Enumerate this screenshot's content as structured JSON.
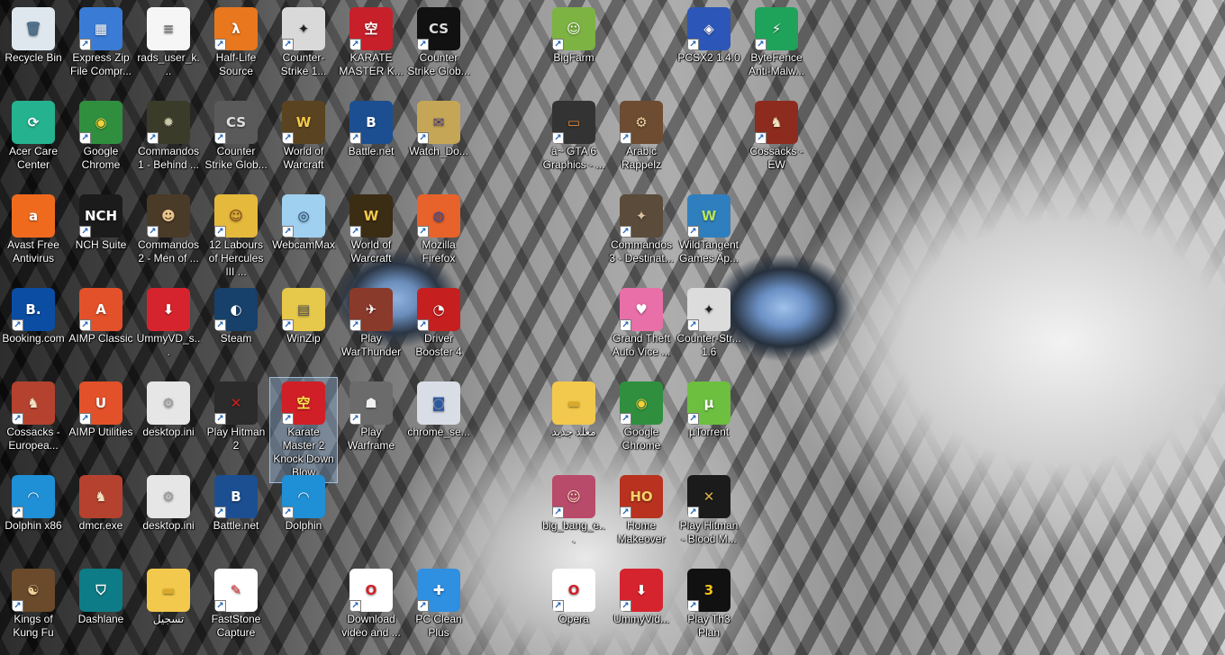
{
  "desktop": {
    "icons": [
      {
        "label": "Recycle Bin",
        "icon": "recycle-bin-icon",
        "glyph": "🗑",
        "bg": "#dfe7ee",
        "fg": "#4c6c8a",
        "shortcut": false
      },
      {
        "label": "Express Zip File Compr...",
        "icon": "express-zip-icon",
        "glyph": "▦",
        "bg": "#3a7bd5",
        "fg": "#ffffff",
        "shortcut": true
      },
      {
        "label": "rads_user_k...",
        "icon": "text-file-icon",
        "glyph": "≡",
        "bg": "#f6f6f6",
        "fg": "#777777",
        "shortcut": false
      },
      {
        "label": "Half-Life Source",
        "icon": "half-life-icon",
        "glyph": "λ",
        "bg": "#e8771d",
        "fg": "#ffffff",
        "shortcut": true
      },
      {
        "label": "Counter-Strike 1...",
        "icon": "counter-strike-icon",
        "glyph": "✦",
        "bg": "#d9d9d9",
        "fg": "#222222",
        "shortcut": true
      },
      {
        "label": "KARATE MASTER K...",
        "icon": "karate-master-icon",
        "glyph": "空",
        "bg": "#c8202a",
        "fg": "#ffffff",
        "shortcut": true
      },
      {
        "label": "Counter Strike Glob...",
        "icon": "csgo-icon",
        "glyph": "CS",
        "bg": "#111111",
        "fg": "#dddddd",
        "shortcut": true
      },
      {
        "label": "BigFarm",
        "icon": "bigfarm-icon",
        "glyph": "☺",
        "bg": "#7cb342",
        "fg": "#ffffff",
        "shortcut": true
      },
      {
        "label": "PCSX2 1.4.0",
        "icon": "pcsx2-icon",
        "glyph": "◈",
        "bg": "#2c56b8",
        "fg": "#ffffff",
        "shortcut": true
      },
      {
        "label": "ByteFence Anti-Malw...",
        "icon": "bytefence-icon",
        "glyph": "⚡",
        "bg": "#1fa35a",
        "fg": "#ffffff",
        "shortcut": true
      },
      {
        "label": "Acer Care Center",
        "icon": "acer-care-icon",
        "glyph": "⟳",
        "bg": "#24b28f",
        "fg": "#ffffff",
        "shortcut": false
      },
      {
        "label": "Google Chrome",
        "icon": "google-chrome-icon",
        "glyph": "◉",
        "bg": "#2f8f3f",
        "fg": "#f5d03b",
        "shortcut": true
      },
      {
        "label": "Commandos 1 - Behind ...",
        "icon": "commandos-grenade-icon",
        "glyph": "✹",
        "bg": "#3b3b2a",
        "fg": "#c9c9a8",
        "shortcut": true
      },
      {
        "label": "Counter Strike Glob...",
        "icon": "csgo-icon",
        "glyph": "CS",
        "bg": "#5a5a5a",
        "fg": "#e0e0e0",
        "shortcut": true
      },
      {
        "label": "World of Warcraft",
        "icon": "world-of-warcraft-icon",
        "glyph": "W",
        "bg": "#5a4320",
        "fg": "#f2c94c",
        "shortcut": true
      },
      {
        "label": "Battle.net",
        "icon": "battlenet-icon",
        "glyph": "B",
        "bg": "#1b4f91",
        "fg": "#ffffff",
        "shortcut": true
      },
      {
        "label": "Watch_Do...",
        "icon": "watch-dogs-icon",
        "glyph": "✉",
        "bg": "#c5a657",
        "fg": "#4b3b7a",
        "shortcut": true
      },
      {
        "label": "â~ GTA 6 Graphics - ...",
        "icon": "gta-graphics-icon",
        "glyph": "▭",
        "bg": "#333333",
        "fg": "#e38a3b",
        "shortcut": true
      },
      {
        "label": "Arabic Rappelz",
        "icon": "rappelz-icon",
        "glyph": "⚙",
        "bg": "#6d4c32",
        "fg": "#f1d3a1",
        "shortcut": true
      },
      {
        "label": "Cossacks - EW",
        "icon": "cossacks-icon",
        "glyph": "♞",
        "bg": "#8d2c1e",
        "fg": "#f4e3c4",
        "shortcut": true
      },
      {
        "label": "Avast Free Antivirus",
        "icon": "avast-icon",
        "glyph": "a",
        "bg": "#f06a1d",
        "fg": "#ffffff",
        "shortcut": false
      },
      {
        "label": "NCH Suite",
        "icon": "nch-suite-icon",
        "glyph": "NCH",
        "bg": "#1b1b1b",
        "fg": "#ffffff",
        "shortcut": true
      },
      {
        "label": "Commandos 2 - Men of ...",
        "icon": "commandos-soldier-icon",
        "glyph": "☻",
        "bg": "#4a3a28",
        "fg": "#e8c38a",
        "shortcut": true
      },
      {
        "label": "12 Labours of Hercules III ...",
        "icon": "hercules-icon",
        "glyph": "☺",
        "bg": "#e5b93b",
        "fg": "#7a3b1a",
        "shortcut": true
      },
      {
        "label": "WebcamMax",
        "icon": "webcammax-icon",
        "glyph": "◎",
        "bg": "#9fd0ef",
        "fg": "#1b3e6b",
        "shortcut": true
      },
      {
        "label": "World of Warcraft",
        "icon": "world-of-warcraft-icon",
        "glyph": "W",
        "bg": "#3b2c14",
        "fg": "#f2c94c",
        "shortcut": true
      },
      {
        "label": "Mozilla Firefox",
        "icon": "firefox-icon",
        "glyph": "◍",
        "bg": "#e8622b",
        "fg": "#2b4fa3",
        "shortcut": true
      },
      {
        "label": "Commandos 3 - Destinat...",
        "icon": "commandos-3-icon",
        "glyph": "✦",
        "bg": "#5a4b3b",
        "fg": "#d9c2a0",
        "shortcut": true
      },
      {
        "label": "WildTangent Games Ap...",
        "icon": "wildtangent-icon",
        "glyph": "W",
        "bg": "#2f7fbf",
        "fg": "#b7e35a",
        "shortcut": true
      },
      {
        "label": "Booking.com",
        "icon": "booking-icon",
        "glyph": "B.",
        "bg": "#0b4da2",
        "fg": "#ffffff",
        "shortcut": true
      },
      {
        "label": "AIMP Classic",
        "icon": "aimp-classic-icon",
        "glyph": "A",
        "bg": "#e2512a",
        "fg": "#ffffff",
        "shortcut": true
      },
      {
        "label": "UmmyVD_s...",
        "icon": "ummy-video-icon",
        "glyph": "⬇",
        "bg": "#d6242f",
        "fg": "#ffffff",
        "shortcut": false
      },
      {
        "label": "Steam",
        "icon": "steam-icon",
        "glyph": "◐",
        "bg": "#17406b",
        "fg": "#ffffff",
        "shortcut": true
      },
      {
        "label": "WinZip",
        "icon": "winzip-icon",
        "glyph": "▤",
        "bg": "#e6c84a",
        "fg": "#555555",
        "shortcut": true
      },
      {
        "label": "Play WarThunder",
        "icon": "warthunder-icon",
        "glyph": "✈",
        "bg": "#8a3a2a",
        "fg": "#ffffff",
        "shortcut": true
      },
      {
        "label": "Driver Booster 4",
        "icon": "driver-booster-icon",
        "glyph": "◔",
        "bg": "#c51f1f",
        "fg": "#ffffff",
        "shortcut": true
      },
      {
        "label": "Grand Theft Auto Vice ...",
        "icon": "gta-vice-city-icon",
        "glyph": "♥",
        "bg": "#e96fa8",
        "fg": "#ffffff",
        "shortcut": true
      },
      {
        "label": "Counter-Str... 1.6",
        "icon": "counter-strike-icon",
        "glyph": "✦",
        "bg": "#dcdcdc",
        "fg": "#222222",
        "shortcut": true
      },
      {
        "label": "Cossacks - Europea...",
        "icon": "cossacks-icon",
        "glyph": "♞",
        "bg": "#b5422f",
        "fg": "#f4e3c4",
        "shortcut": true
      },
      {
        "label": "AIMP Utilities",
        "icon": "aimp-utilities-icon",
        "glyph": "U",
        "bg": "#e2512a",
        "fg": "#ffffff",
        "shortcut": true
      },
      {
        "label": "desktop.ini",
        "icon": "settings-file-icon",
        "glyph": "⚙",
        "bg": "#e6e6e6",
        "fg": "#9a9a9a",
        "shortcut": false
      },
      {
        "label": "Play Hitman 2",
        "icon": "hitman-icon",
        "glyph": "✕",
        "bg": "#2b2b2b",
        "fg": "#d11f1f",
        "shortcut": true
      },
      {
        "label": "Karate Master 2 Knock Down Blow",
        "icon": "karate-master-icon",
        "glyph": "空",
        "bg": "#d01f27",
        "fg": "#ffe74a",
        "shortcut": true
      },
      {
        "label": "Play Warframe",
        "icon": "warframe-icon",
        "glyph": "☗",
        "bg": "#6b6b6b",
        "fg": "#f0f0f0",
        "shortcut": true
      },
      {
        "label": "chrome_se...",
        "icon": "installer-icon",
        "glyph": "◙",
        "bg": "#d8dde6",
        "fg": "#2c5aa0",
        "shortcut": false
      },
      {
        "label": "معلد جديد",
        "icon": "folder-icon",
        "glyph": "▬",
        "bg": "#f2c94c",
        "fg": "#d9a92c",
        "shortcut": false
      },
      {
        "label": "Google Chrome",
        "icon": "google-chrome-icon",
        "glyph": "◉",
        "bg": "#2f8f3f",
        "fg": "#f5d03b",
        "shortcut": true
      },
      {
        "label": "µTorrent",
        "icon": "utorrent-icon",
        "glyph": "µ",
        "bg": "#6cbf3f",
        "fg": "#ffffff",
        "shortcut": true
      },
      {
        "label": "Dolphin x86",
        "icon": "dolphin-icon",
        "glyph": "◠",
        "bg": "#1f8fd6",
        "fg": "#ffffff",
        "shortcut": true
      },
      {
        "label": "dmcr.exe",
        "icon": "cossacks-icon",
        "glyph": "♞",
        "bg": "#b5422f",
        "fg": "#f4e3c4",
        "shortcut": false
      },
      {
        "label": "desktop.ini",
        "icon": "settings-file-icon",
        "glyph": "⚙",
        "bg": "#e6e6e6",
        "fg": "#9a9a9a",
        "shortcut": false
      },
      {
        "label": "Battle.net",
        "icon": "battlenet-icon",
        "glyph": "B",
        "bg": "#1b4f91",
        "fg": "#ffffff",
        "shortcut": true
      },
      {
        "label": "Dolphin",
        "icon": "dolphin-icon",
        "glyph": "◠",
        "bg": "#1f8fd6",
        "fg": "#ffffff",
        "shortcut": true
      },
      {
        "label": "big_bang_e...",
        "icon": "big-bang-icon",
        "glyph": "☺",
        "bg": "#b84a6a",
        "fg": "#ffe0c4",
        "shortcut": true
      },
      {
        "label": "Home Makeover",
        "icon": "hidden-object-icon",
        "glyph": "HO",
        "bg": "#b8321f",
        "fg": "#f5d26a",
        "shortcut": true
      },
      {
        "label": "Play Hitman - Blood M...",
        "icon": "hitman-icon",
        "glyph": "✕",
        "bg": "#1b1b1b",
        "fg": "#d8b04a",
        "shortcut": true
      },
      {
        "label": "Kings of Kung Fu",
        "icon": "kung-fu-icon",
        "glyph": "☯",
        "bg": "#6a4a2a",
        "fg": "#f1d39a",
        "shortcut": true
      },
      {
        "label": "Dashlane",
        "icon": "dashlane-icon",
        "glyph": "⛉",
        "bg": "#0e7c86",
        "fg": "#ffffff",
        "shortcut": false
      },
      {
        "label": "تسجيل",
        "icon": "folder-icon",
        "glyph": "▬",
        "bg": "#f2c94c",
        "fg": "#d9a92c",
        "shortcut": false
      },
      {
        "label": "FastStone Capture",
        "icon": "faststone-icon",
        "glyph": "✎",
        "bg": "#ffffff",
        "fg": "#d11f1f",
        "shortcut": true
      },
      {
        "label": "Download video and ...",
        "icon": "opera-icon",
        "glyph": "O",
        "bg": "#ffffff",
        "fg": "#d11f2a",
        "shortcut": true
      },
      {
        "label": "PC Clean Plus",
        "icon": "pc-clean-icon",
        "glyph": "✚",
        "bg": "#2f8fe0",
        "fg": "#ffffff",
        "shortcut": true
      },
      {
        "label": "Opera",
        "icon": "opera-icon",
        "glyph": "O",
        "bg": "#ffffff",
        "fg": "#d11f2a",
        "shortcut": true
      },
      {
        "label": "UmmyVid...",
        "icon": "ummy-video-icon",
        "glyph": "⬇",
        "bg": "#d6242f",
        "fg": "#ffffff",
        "shortcut": true
      },
      {
        "label": "Play Th3 Plan",
        "icon": "th3-plan-icon",
        "glyph": "3",
        "bg": "#111111",
        "fg": "#f2c21b",
        "shortcut": true
      }
    ]
  }
}
